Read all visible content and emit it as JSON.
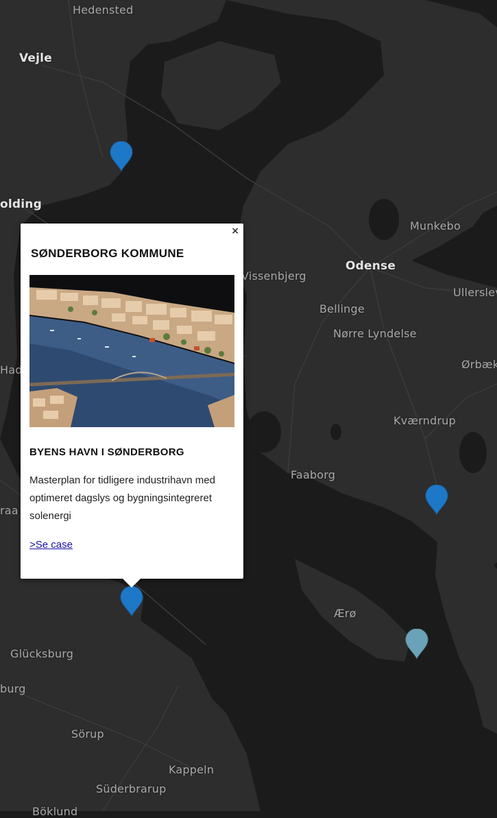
{
  "map": {
    "place_labels": [
      {
        "id": "hedensted",
        "text": "Hedensted",
        "major": false
      },
      {
        "id": "vejle",
        "text": "Vejle",
        "major": true
      },
      {
        "id": "kolding",
        "text": "olding",
        "major": true
      },
      {
        "id": "munkebo",
        "text": "Munkebo",
        "major": false
      },
      {
        "id": "odense",
        "text": "Odense",
        "major": true
      },
      {
        "id": "vissenbjerg",
        "text": "Vissenbjerg",
        "major": false
      },
      {
        "id": "ullerslev",
        "text": "Ullerslev",
        "major": false
      },
      {
        "id": "bellinge",
        "text": "Bellinge",
        "major": false
      },
      {
        "id": "norre-lyndelse",
        "text": "Nørre Lyndelse",
        "major": false
      },
      {
        "id": "orbaek",
        "text": "Ørbæk",
        "major": false
      },
      {
        "id": "hade",
        "text": "Hade",
        "major": false
      },
      {
        "id": "kvaerndrup",
        "text": "Kværndrup",
        "major": false
      },
      {
        "id": "faaborg",
        "text": "Faaborg",
        "major": false
      },
      {
        "id": "raa",
        "text": "raa",
        "major": false
      },
      {
        "id": "aero",
        "text": "Ærø",
        "major": false
      },
      {
        "id": "glucksburg",
        "text": "Glücksburg",
        "major": false
      },
      {
        "id": "burg",
        "text": "burg",
        "major": false
      },
      {
        "id": "sorup",
        "text": "Sörup",
        "major": false
      },
      {
        "id": "kappeln",
        "text": "Kappeln",
        "major": false
      },
      {
        "id": "suderbrarup",
        "text": "Süderbrarup",
        "major": false
      },
      {
        "id": "boklund",
        "text": "Böklund",
        "major": false
      }
    ],
    "markers": [
      {
        "id": "marker-vejle-fjord",
        "color": "#1e78c8"
      },
      {
        "id": "marker-svendborg",
        "color": "#1e78c8"
      },
      {
        "id": "marker-sonderborg",
        "color": "#1e78c8"
      },
      {
        "id": "marker-langeland",
        "color": "#6aa3b8"
      }
    ],
    "colors": {
      "water": "#1b1b1b",
      "land": "#2d2d2d",
      "roads": "#3a3a3a"
    }
  },
  "popup": {
    "close_label": "×",
    "title": "SØNDERBORG KOMMUNE",
    "image_alt_icon": "harbour-masterplan-photo",
    "subtitle": "BYENS HAVN I SØNDERBORG",
    "description": "Masterplan for tidligere industrihavn med optimeret dagslys og bygningsintegreret solenergi",
    "link_label": ">Se case"
  }
}
